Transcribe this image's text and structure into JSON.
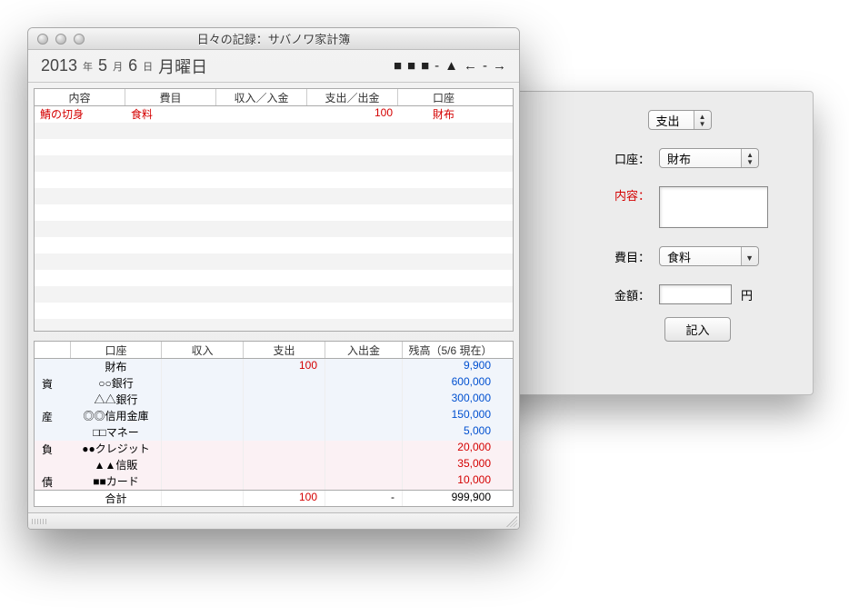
{
  "window": {
    "title": "日々の記録：サバノワ家計簿"
  },
  "date": {
    "year": "2013",
    "year_suffix": "年",
    "month": "5",
    "month_suffix": "月",
    "day": "6",
    "day_suffix": "日",
    "weekday": "月曜日"
  },
  "nav": {
    "block1": "■",
    "block2": "■",
    "block3": "■",
    "dash": "-",
    "triangle": "▲",
    "prev": "←",
    "dash2": "-",
    "next": "→"
  },
  "list": {
    "headers": {
      "c1": "内容",
      "c2": "費目",
      "c3": "収入／入金",
      "c4": "支出／出金",
      "c5": "口座"
    },
    "rows": [
      {
        "c1": "鯖の切身",
        "c2": "食料",
        "c3": "",
        "c4": "100",
        "c5": "財布"
      }
    ]
  },
  "summary": {
    "headers": {
      "c1": "",
      "c2": "口座",
      "c3": "収入",
      "c4": "支出",
      "c5": "入出金",
      "c6": "残高（5/6 現在）"
    },
    "categories": {
      "asset1": "資",
      "asset2": "産",
      "debt1": "負",
      "debt2": "債"
    },
    "rows": [
      {
        "acct": "財布",
        "income": "",
        "expense": "100",
        "transfer": "",
        "balance": "9,900",
        "type": "asset"
      },
      {
        "acct": "○○銀行",
        "income": "",
        "expense": "",
        "transfer": "",
        "balance": "600,000",
        "type": "asset"
      },
      {
        "acct": "△△銀行",
        "income": "",
        "expense": "",
        "transfer": "",
        "balance": "300,000",
        "type": "asset"
      },
      {
        "acct": "◎◎信用金庫",
        "income": "",
        "expense": "",
        "transfer": "",
        "balance": "150,000",
        "type": "asset"
      },
      {
        "acct": "□□マネー",
        "income": "",
        "expense": "",
        "transfer": "",
        "balance": "5,000",
        "type": "asset"
      },
      {
        "acct": "●●クレジット",
        "income": "",
        "expense": "",
        "transfer": "",
        "balance": "20,000",
        "type": "debt"
      },
      {
        "acct": "▲▲信販",
        "income": "",
        "expense": "",
        "transfer": "",
        "balance": "35,000",
        "type": "debt"
      },
      {
        "acct": "■■カード",
        "income": "",
        "expense": "",
        "transfer": "",
        "balance": "10,000",
        "type": "debt"
      }
    ],
    "total": {
      "label": "合計",
      "income": "",
      "expense": "100",
      "transfer": "-",
      "balance": "999,900"
    }
  },
  "form": {
    "type_value": "支出",
    "account_label": "口座：",
    "account_value": "財布",
    "content_label": "内容：",
    "content_value": "",
    "category_label": "費目：",
    "category_value": "食料",
    "amount_label": "金額：",
    "amount_value": "",
    "amount_unit": "円",
    "submit": "記入"
  }
}
